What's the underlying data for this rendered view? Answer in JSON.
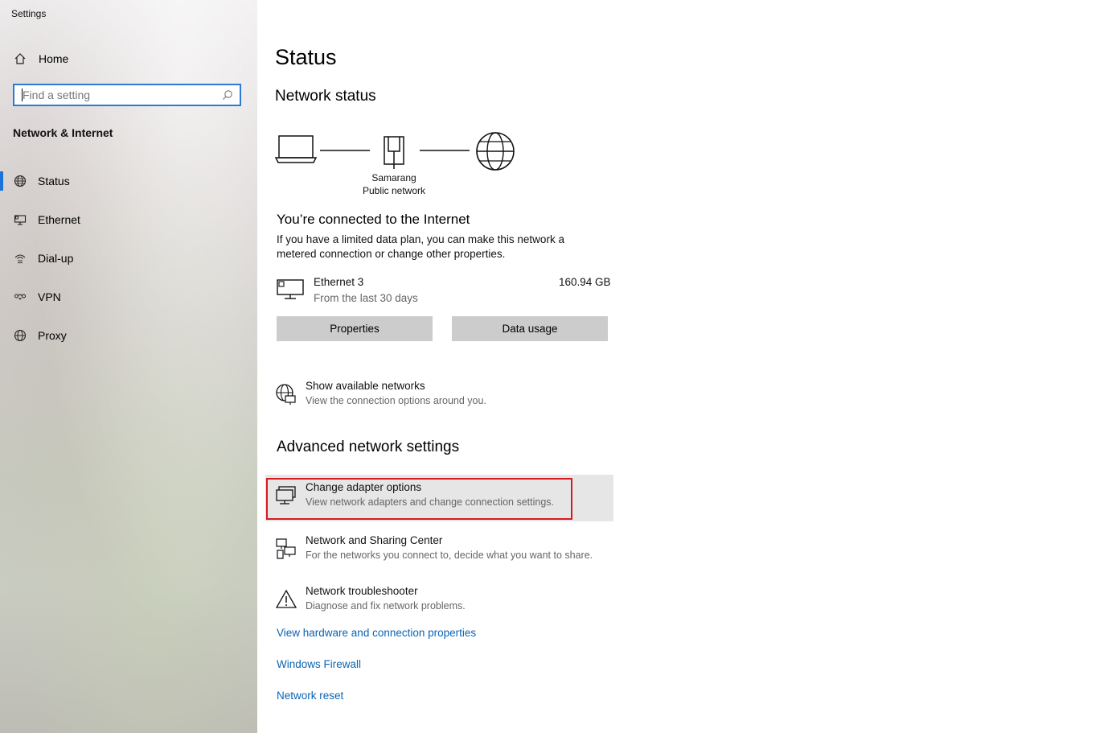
{
  "window": {
    "title": "Settings"
  },
  "sidebar": {
    "home_label": "Home",
    "search": {
      "placeholder": "Find a setting"
    },
    "section_title": "Network & Internet",
    "items": [
      {
        "label": "Status",
        "icon": "globe-status-icon",
        "active": true
      },
      {
        "label": "Ethernet",
        "icon": "ethernet-icon"
      },
      {
        "label": "Dial-up",
        "icon": "dialup-icon"
      },
      {
        "label": "VPN",
        "icon": "vpn-icon"
      },
      {
        "label": "Proxy",
        "icon": "globe-icon"
      }
    ]
  },
  "main": {
    "title": "Status",
    "network_status": {
      "heading": "Network status",
      "network_name": "Samarang",
      "network_type": "Public network"
    },
    "connected_heading": "You’re connected to the Internet",
    "connected_desc": "If you have a limited data plan, you can make this network a metered connection or change other properties.",
    "adapter": {
      "name": "Ethernet 3",
      "sub": "From the last 30 days",
      "usage": "160.94 GB"
    },
    "buttons": {
      "properties": "Properties",
      "data_usage": "Data usage"
    },
    "show_networks": {
      "title": "Show available networks",
      "sub": "View the connection options around you."
    },
    "advanced_heading": "Advanced network settings",
    "advanced_items": [
      {
        "title": "Change adapter options",
        "sub": "View network adapters and change connection settings."
      },
      {
        "title": "Network and Sharing Center",
        "sub": "For the networks you connect to, decide what you want to share."
      },
      {
        "title": "Network troubleshooter",
        "sub": "Diagnose and fix network problems."
      }
    ],
    "links": [
      "View hardware and connection properties",
      "Windows Firewall",
      "Network reset"
    ]
  },
  "colors": {
    "accent": "#1a73d9",
    "link": "#0a63b5",
    "highlight": "#d71920",
    "button": "#cccccc"
  }
}
